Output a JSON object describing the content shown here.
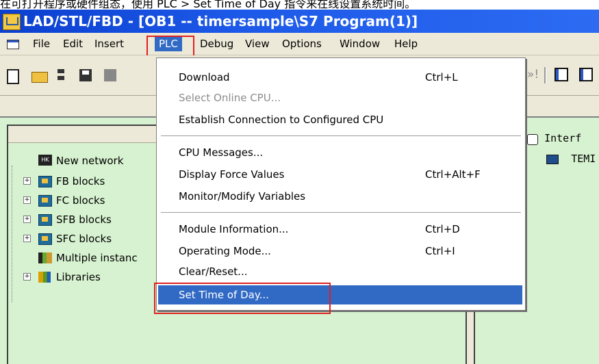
{
  "caption": "在可打开程序或硬件组态，使用 PLC > Set Time of Day 指令来在线设置系统时间。",
  "window": {
    "title": "LAD/STL/FBD  - [OB1 -- timersample\\S7 Program(1)]"
  },
  "menubar": {
    "items": [
      {
        "label": "File"
      },
      {
        "label": "Edit"
      },
      {
        "label": "Insert"
      },
      {
        "label": "PLC"
      },
      {
        "label": "Debug"
      },
      {
        "label": "View"
      },
      {
        "label": "Options"
      },
      {
        "label": "Window"
      },
      {
        "label": "Help"
      }
    ],
    "active": "PLC"
  },
  "toolbar": {
    "forward_glyph": "»!"
  },
  "plc_menu": {
    "items": [
      {
        "label": "Download",
        "shortcut": "Ctrl+L",
        "state": "enabled"
      },
      {
        "label": "Select Online CPU...",
        "shortcut": "",
        "state": "disabled"
      },
      {
        "label": "Establish Connection to Configured CPU",
        "shortcut": "",
        "state": "enabled"
      },
      {
        "label": "CPU Messages...",
        "shortcut": "",
        "state": "enabled"
      },
      {
        "label": "Display Force Values",
        "shortcut": "Ctrl+Alt+F",
        "state": "enabled"
      },
      {
        "label": "Monitor/Modify Variables",
        "shortcut": "",
        "state": "enabled"
      },
      {
        "label": "Module Information...",
        "shortcut": "Ctrl+D",
        "state": "enabled"
      },
      {
        "label": "Operating Mode...",
        "shortcut": "Ctrl+I",
        "state": "enabled"
      },
      {
        "label": "Clear/Reset...",
        "shortcut": "",
        "state": "enabled"
      },
      {
        "label": "Set Time of Day...",
        "shortcut": "",
        "state": "selected"
      }
    ]
  },
  "tree": {
    "items": [
      {
        "label": "New network",
        "expandable": false,
        "icon": "new-network-icon"
      },
      {
        "label": "FB blocks",
        "expandable": true,
        "icon": "block-folder-icon"
      },
      {
        "label": "FC blocks",
        "expandable": true,
        "icon": "block-folder-icon"
      },
      {
        "label": "SFB blocks",
        "expandable": true,
        "icon": "block-folder-icon"
      },
      {
        "label": "SFC blocks",
        "expandable": true,
        "icon": "block-folder-icon"
      },
      {
        "label": "Multiple instanc",
        "expandable": false,
        "icon": "multiple-instance-icon"
      },
      {
        "label": "Libraries",
        "expandable": true,
        "icon": "libraries-icon"
      }
    ]
  },
  "interface": {
    "title": "Interf",
    "temp": "TEMI"
  },
  "colors": {
    "title_bar": "#1d59e8",
    "menu_selected": "#316ac5",
    "pane_background": "#d7f2d0",
    "highlight_box": "#e02020"
  }
}
